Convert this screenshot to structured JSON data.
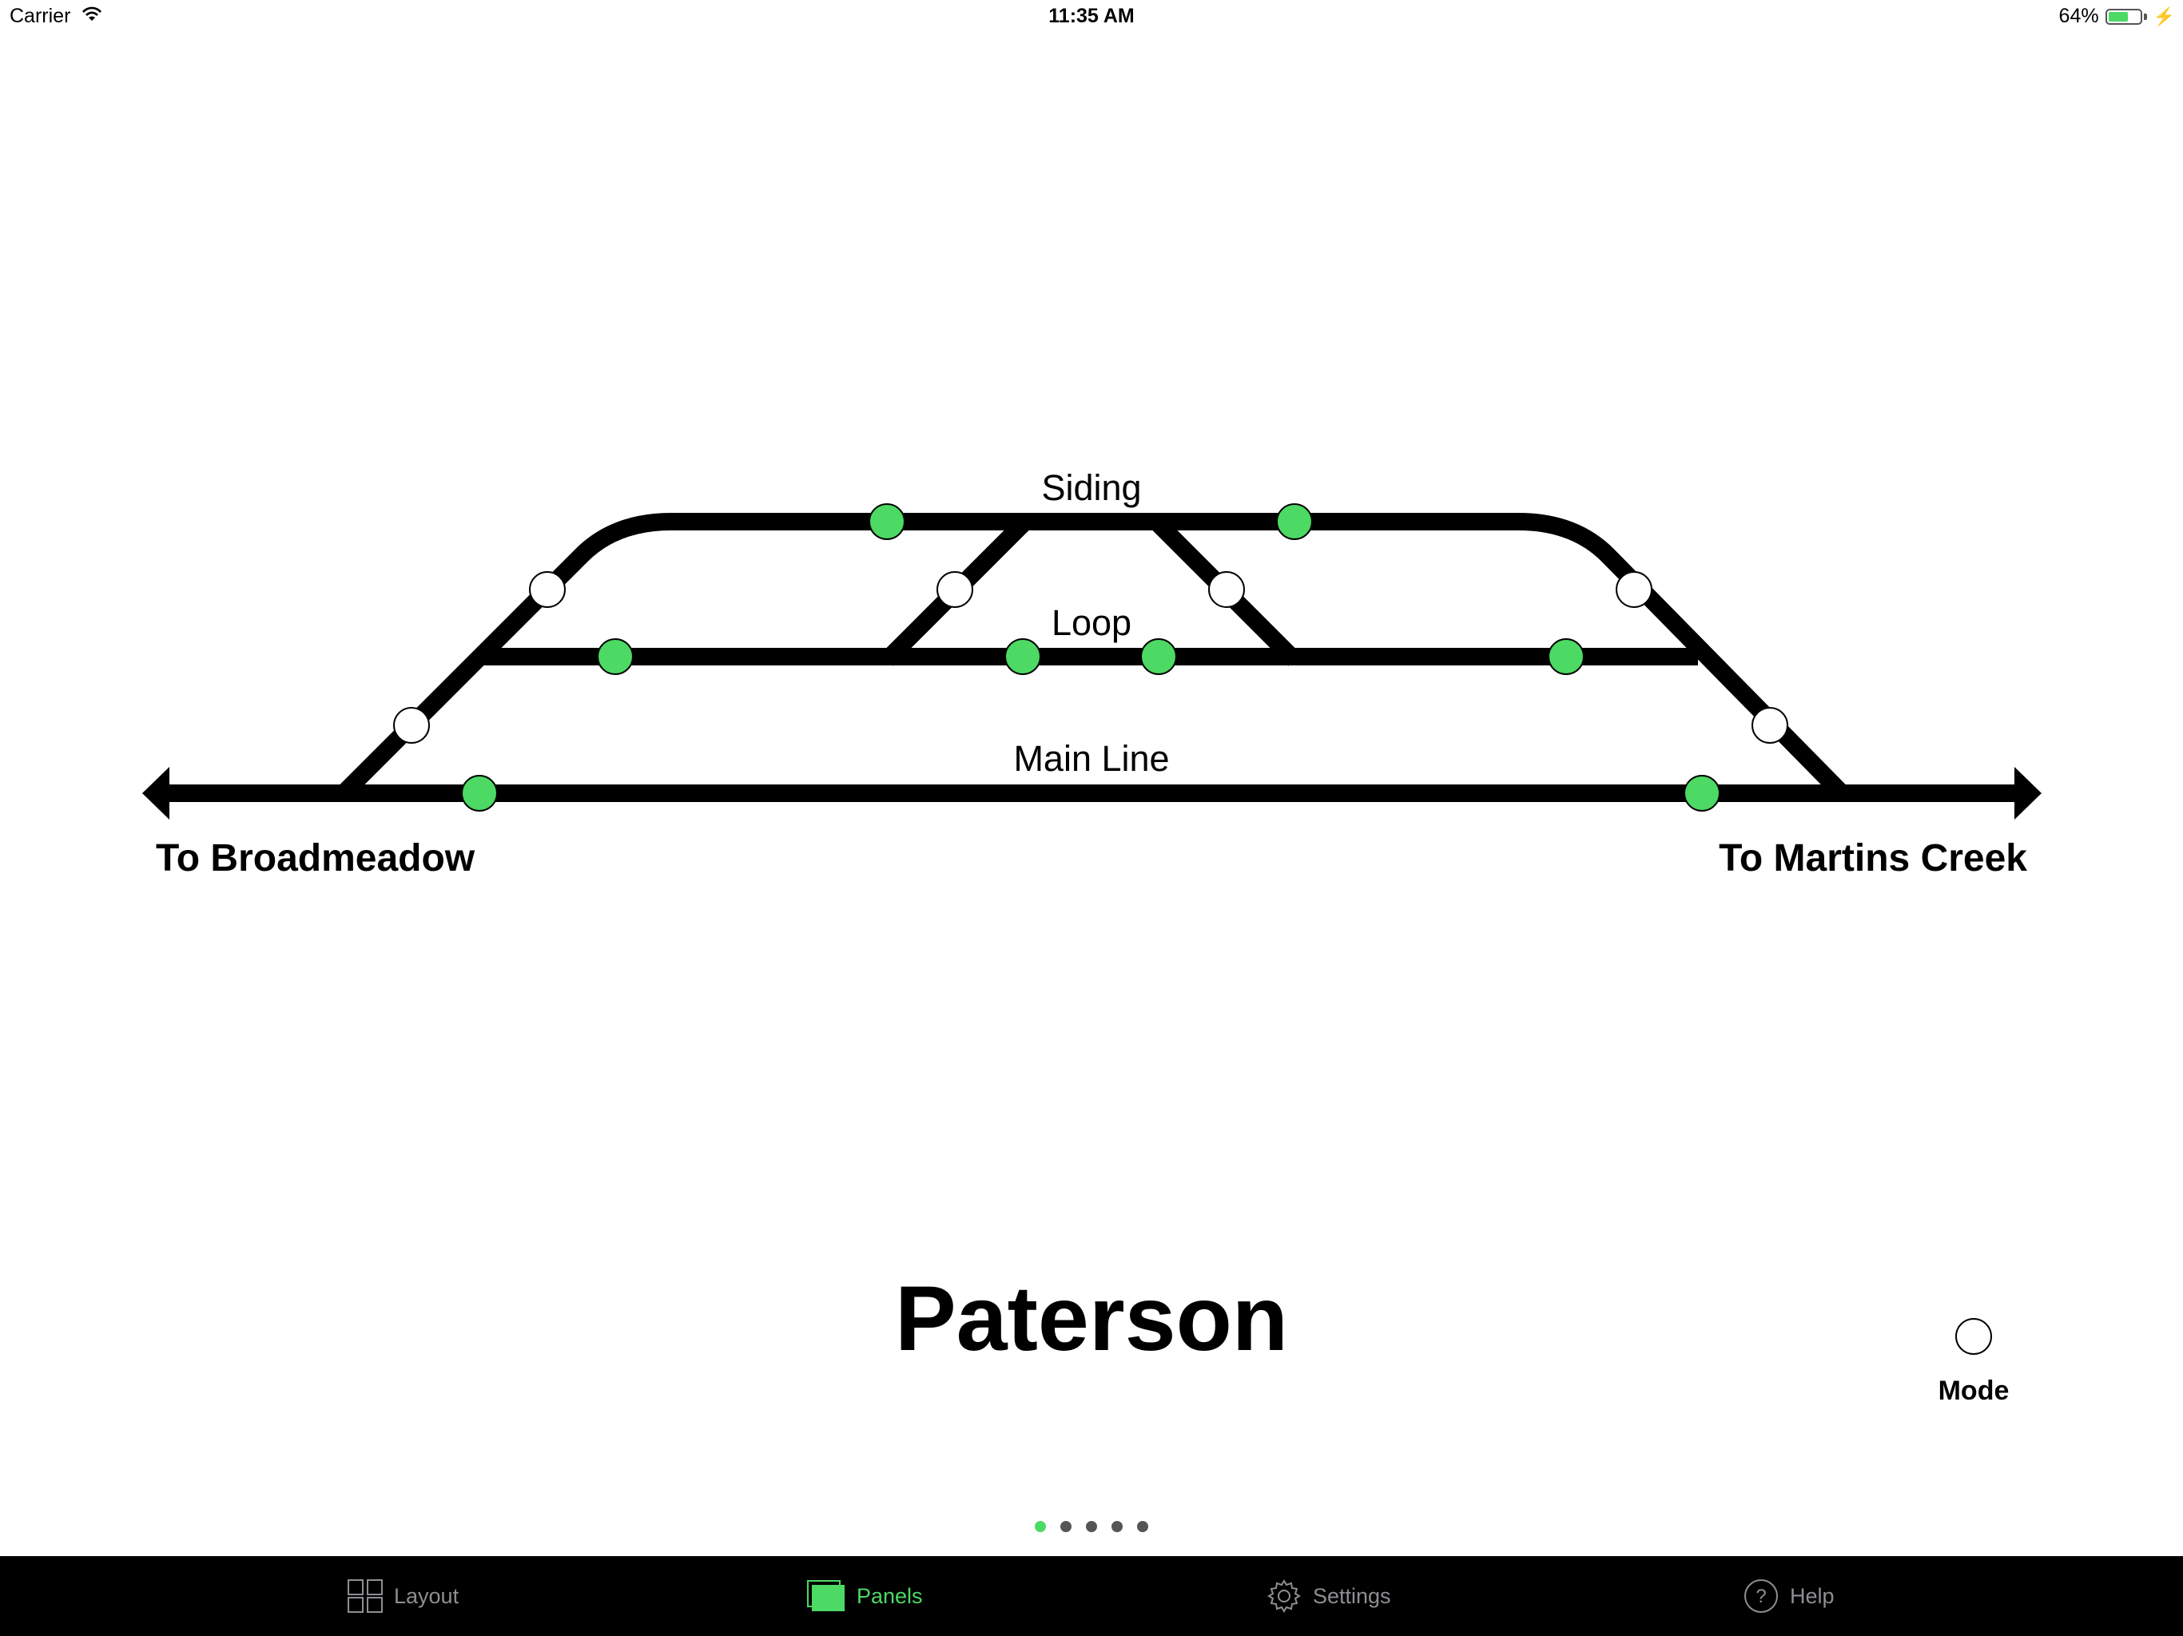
{
  "status_bar": {
    "carrier": "Carrier",
    "time": "11:35 AM",
    "battery": "64%",
    "battery_level": 0.64
  },
  "diagram": {
    "tracks": {
      "siding": "Siding",
      "loop": "Loop",
      "main_line": "Main Line"
    },
    "destinations": {
      "left": "To Broadmeadow",
      "right": "To Martins Creek"
    },
    "colors": {
      "track": "#000000",
      "signal_clear": "#4cd964",
      "point_indicator": "#ffffff"
    }
  },
  "station": {
    "name": "Paterson"
  },
  "mode": {
    "label": "Mode"
  },
  "pager": {
    "count": 5,
    "active_index": 0,
    "active_color": "#4cd964"
  },
  "tabs": [
    {
      "label": "Layout",
      "icon": "grid-icon",
      "active": false
    },
    {
      "label": "Panels",
      "icon": "panels-icon",
      "active": true
    },
    {
      "label": "Settings",
      "icon": "gear-icon",
      "active": false
    },
    {
      "label": "Help",
      "icon": "help-icon",
      "active": false
    }
  ]
}
